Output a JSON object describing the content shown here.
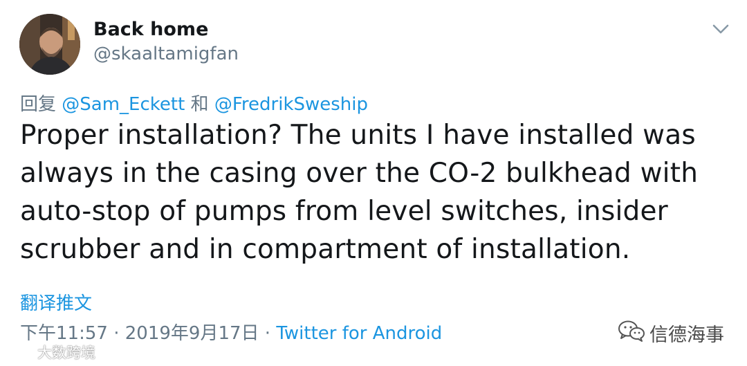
{
  "tweet": {
    "author": {
      "display_name": "Back home",
      "handle": "@skaaltamigfan"
    },
    "menu_icon": "chevron-down-icon",
    "reply": {
      "prefix": "回复",
      "mention_1": "@Sam_Eckett",
      "conjunction": "和",
      "mention_2": "@FredrikSweship"
    },
    "text": "Proper installation? The units I have installed was always in the casing over the CO-2 bulkhead with auto-stop of pumps from level switches, insider scrubber and in compartment of installation.",
    "translate_label": "翻译推文",
    "time": "下午11:57",
    "separator": "·",
    "date": "2019年9月17日",
    "source": "Twitter for Android"
  },
  "watermarks": {
    "right": "信德海事",
    "left": "大数跨境"
  },
  "colors": {
    "link": "#1b95e0",
    "secondary": "#657786",
    "text": "#14171a"
  }
}
